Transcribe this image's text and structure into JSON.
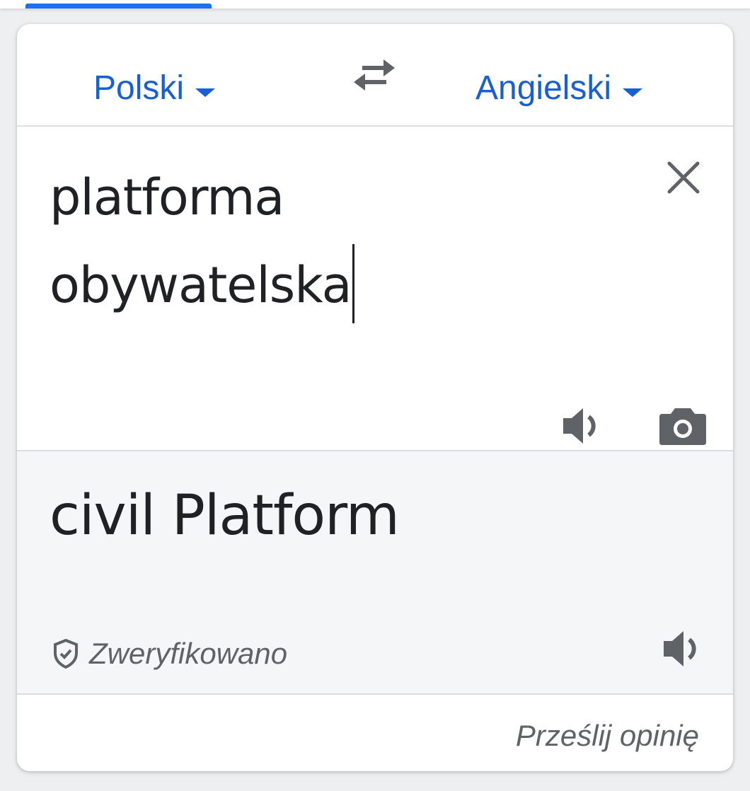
{
  "languages": {
    "source_label": "Polski",
    "target_label": "Angielski"
  },
  "input": {
    "line1": "platforma",
    "line2": "obywatelska"
  },
  "output": {
    "translation": "civil Platform",
    "verified_label": "Zweryfikowano"
  },
  "footer": {
    "feedback_label": "Prześlij opinię"
  },
  "icons": {
    "swap": "swap-arrows-icon",
    "clear": "close-icon",
    "speak": "speaker-icon",
    "camera": "camera-icon",
    "verified": "shield-check-icon"
  },
  "colors": {
    "accent": "#1a5fd1",
    "tab_indicator": "#1a73e8",
    "result_bg": "#f5f6f8",
    "icon_gray": "#5f6368",
    "text": "#202124"
  }
}
